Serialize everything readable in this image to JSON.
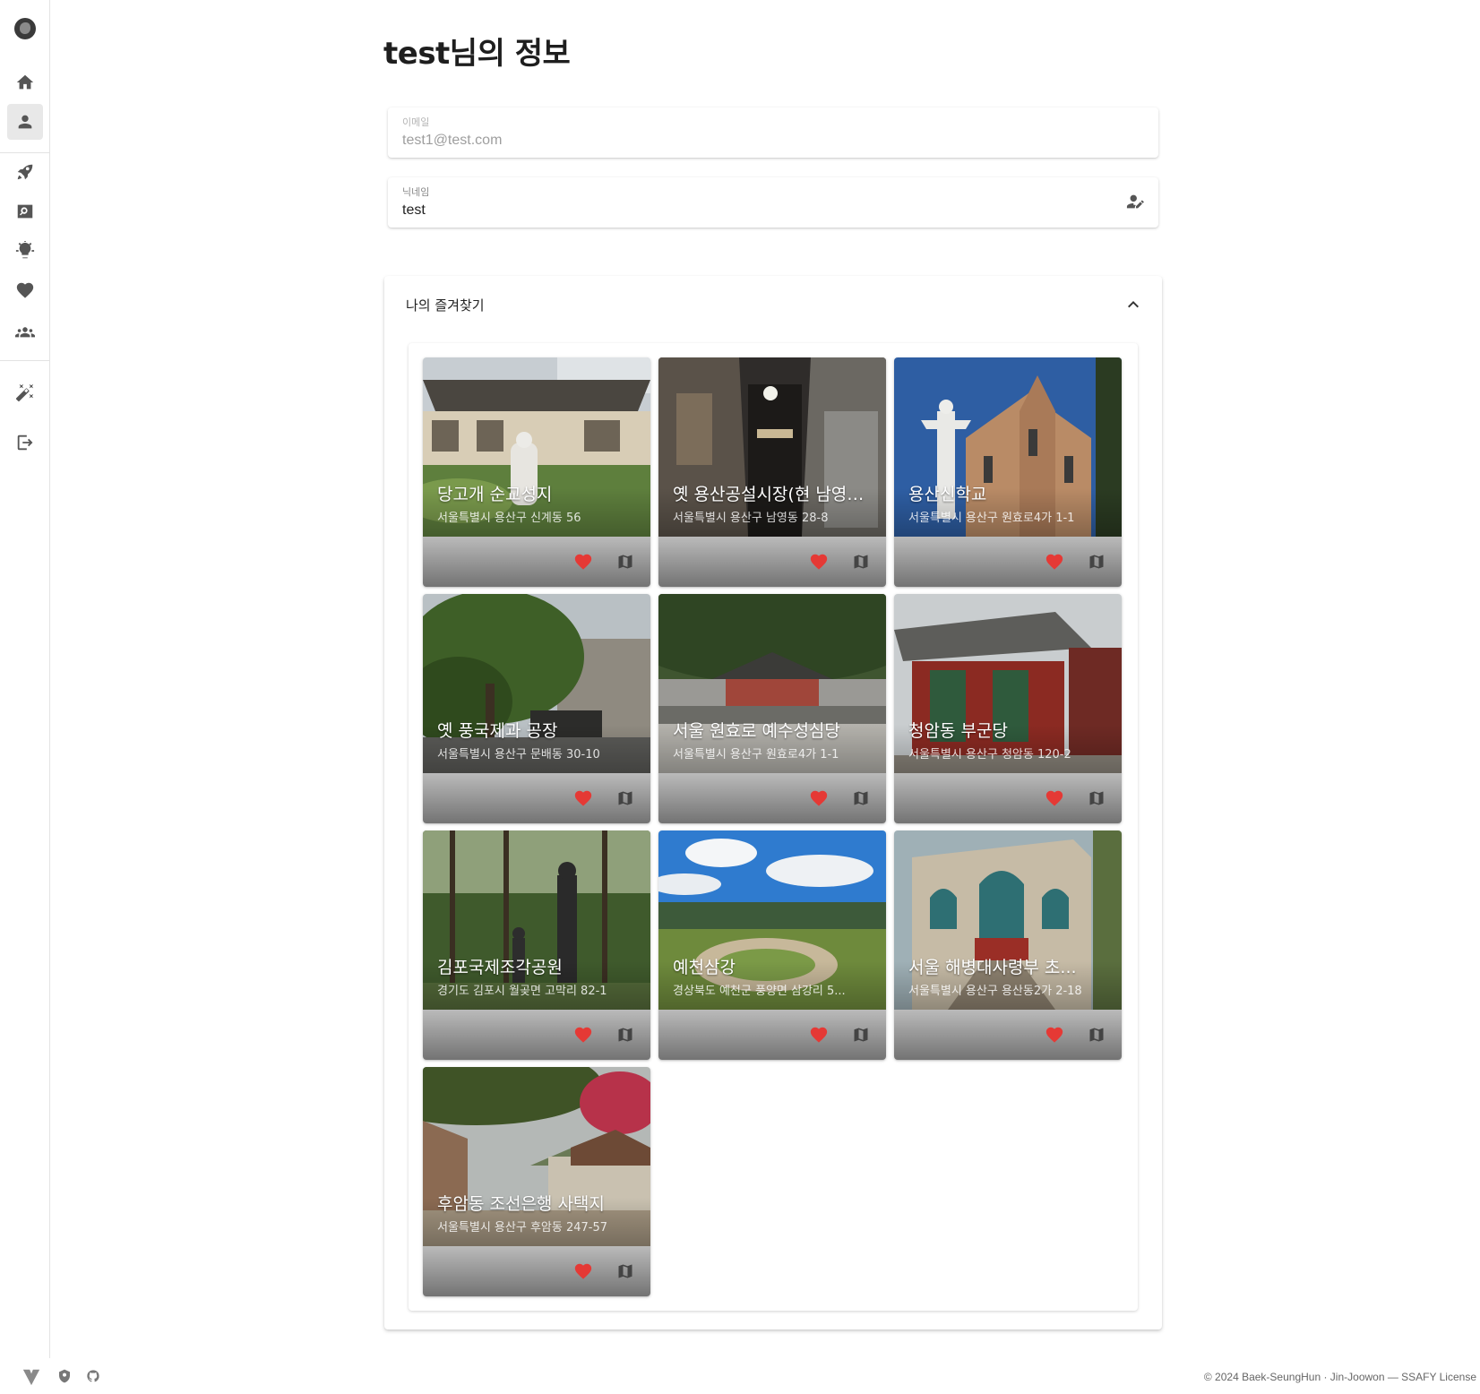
{
  "sidebar": {
    "items": [
      {
        "icon": "home-icon"
      },
      {
        "icon": "account-icon",
        "active": true
      },
      {
        "icon": "rocket-icon"
      },
      {
        "icon": "image-search-icon"
      },
      {
        "icon": "lightbulb-icon"
      },
      {
        "icon": "heart-icon"
      },
      {
        "icon": "group-icon"
      },
      {
        "icon": "theme-toggle-icon"
      },
      {
        "icon": "logout-icon"
      }
    ]
  },
  "page": {
    "title": "test님의 정보"
  },
  "email_field": {
    "label": "이메일",
    "value": "test1@test.com"
  },
  "nickname_field": {
    "label": "닉네임",
    "value": "test"
  },
  "favorites": {
    "title": "나의 즐겨찾기",
    "cards": [
      {
        "title": "당고개 순교성지",
        "address": "서울특별시 용산구 신계동 56"
      },
      {
        "title": "옛 용산공설시장(현 남영동 골목)",
        "address": "서울특별시 용산구 남영동 28-8"
      },
      {
        "title": "용산신학교",
        "address": "서울특별시 용산구 원효로4가 1-1"
      },
      {
        "title": "옛 풍국제과 공장",
        "address": "서울특별시 용산구 문배동 30-10"
      },
      {
        "title": "서울 원효로 예수성심당",
        "address": "서울특별시 용산구 원효로4가 1-1"
      },
      {
        "title": "청암동 부군당",
        "address": "서울특별시 용산구 청암동 120-2"
      },
      {
        "title": "김포국제조각공원",
        "address": "경기도 김포시 월곶면 고막리 82-1"
      },
      {
        "title": "예천삼강",
        "address": "경상북도 예천군 풍양면 삼강리 5..."
      },
      {
        "title": "서울 해병대사령부 초...",
        "address": "서울특별시 용산구 용산동2가 2-18"
      },
      {
        "title": "후암동 조선은행 사택지",
        "address": "서울특별시 용산구 후암동 247-57"
      }
    ]
  },
  "footer": {
    "text": "© 2024 Baek-SeungHun · Jin-Joowon — SSAFY License"
  },
  "colors": {
    "heart": "#e53935",
    "sidebar_active": "#e8e8e8"
  }
}
